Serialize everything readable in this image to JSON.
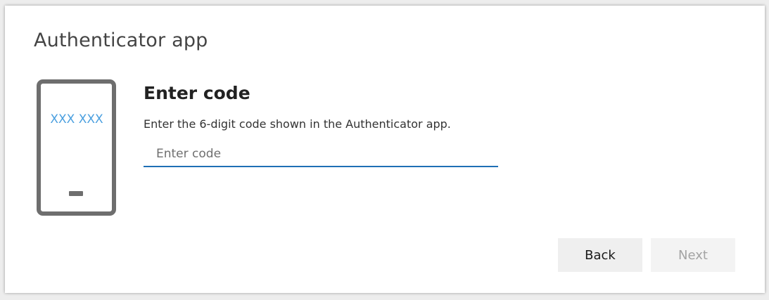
{
  "dialog": {
    "title": "Authenticator app"
  },
  "phone": {
    "code_text": "XXX XXX",
    "code_color": "#4a9fdf",
    "frame_color": "#6e6e6e"
  },
  "content": {
    "heading": "Enter code",
    "description": "Enter the 6-digit code shown in the Authenticator app.",
    "code_input": {
      "placeholder": "Enter code",
      "value": ""
    }
  },
  "buttons": {
    "back_label": "Back",
    "next_label": "Next",
    "next_enabled": false
  },
  "colors": {
    "input_underline": "#1f6fb5",
    "disabled_text": "#a3a3a3"
  }
}
